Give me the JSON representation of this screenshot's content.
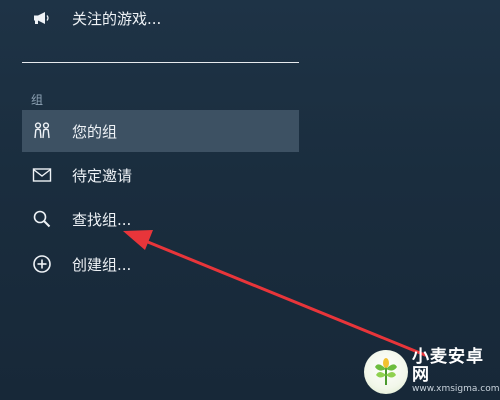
{
  "menu": {
    "followed_games": {
      "label": "关注的游戏...",
      "icon": "megaphone-icon"
    },
    "groups_header": "组",
    "items": [
      {
        "label": "您的组",
        "icon": "people-icon",
        "selected": true
      },
      {
        "label": "待定邀请",
        "icon": "envelope-icon",
        "selected": false
      },
      {
        "label": "查找组...",
        "icon": "search-icon",
        "selected": false
      },
      {
        "label": "创建组...",
        "icon": "plus-circle-icon",
        "selected": false
      }
    ]
  },
  "annotation": {
    "type": "arrow",
    "color": "#e8353a"
  },
  "watermark": {
    "title": "小麦安卓网",
    "url": "www.xmsigma.com"
  },
  "colors": {
    "background": "#1b2e3f",
    "selected_background": "#3d5163",
    "text": "#eef2f6",
    "section_header": "#8fa4b6",
    "arrow": "#e8353a"
  }
}
